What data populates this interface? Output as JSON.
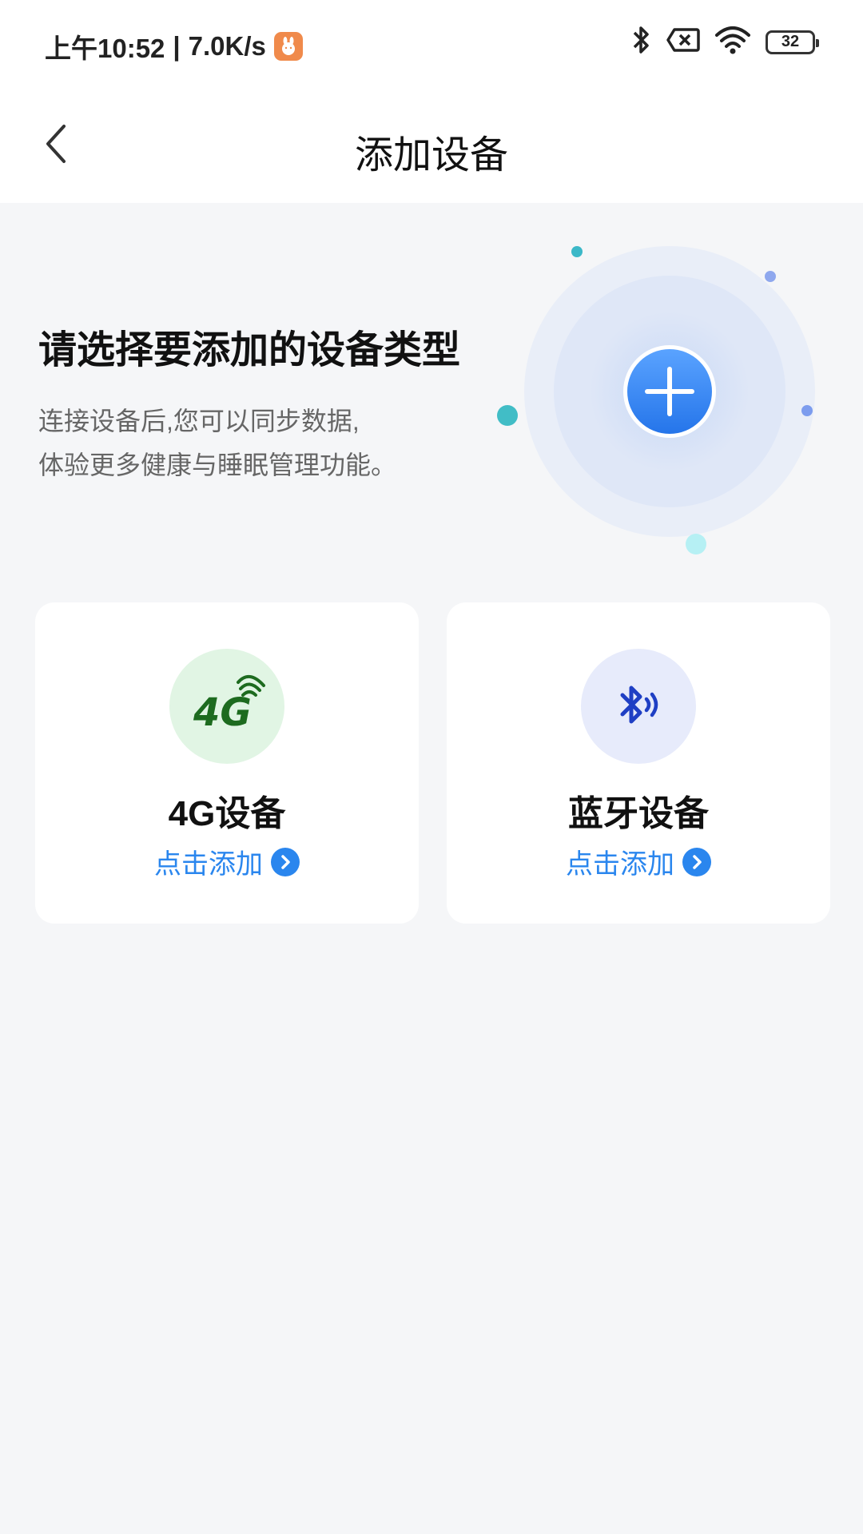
{
  "status_bar": {
    "time": "上午10:52",
    "separator": "|",
    "net_speed": "7.0K/s",
    "app_icon": "rabbit-app-icon",
    "icons": [
      "bluetooth-icon",
      "no-sim-icon",
      "wifi-icon"
    ],
    "battery": "32"
  },
  "nav": {
    "back_icon": "chevron-left-icon",
    "title": "添加设备"
  },
  "hero": {
    "heading": "请选择要添加的设备类型",
    "desc_line1": "连接设备后,您可以同步数据,",
    "desc_line2": "体验更多健康与睡眠管理功能。",
    "graphic_icon": "plus-icon"
  },
  "cards": [
    {
      "icon": "4g-signal-icon",
      "icon_text": "4G",
      "title": "4G设备",
      "action": "点击添加",
      "icon_bg": "#e1f5e4",
      "icon_color": "#1d6b1f"
    },
    {
      "icon": "bluetooth-signal-icon",
      "title": "蓝牙设备",
      "action": "点击添加",
      "icon_bg": "#e7ebfb",
      "icon_color": "#1f3fc4"
    }
  ],
  "colors": {
    "accent": "#2a86ee",
    "background": "#f5f6f8",
    "card": "#ffffff"
  }
}
